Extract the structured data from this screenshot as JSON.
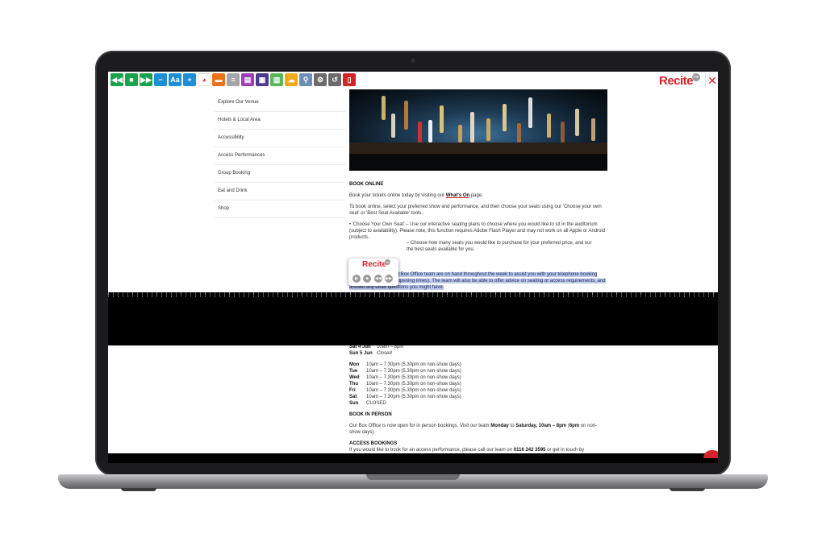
{
  "toolbar": {
    "buttons": [
      {
        "name": "rewind-button",
        "icon": "rewind-icon",
        "glyph": "◀◀",
        "color": "#1aa14b"
      },
      {
        "name": "stop-button",
        "icon": "stop-icon",
        "glyph": "■",
        "color": "#1aa14b"
      },
      {
        "name": "fast-forward-button",
        "icon": "fast-forward-icon",
        "glyph": "▶▶",
        "color": "#1aa14b"
      },
      {
        "name": "decrease-text-button",
        "icon": "minus-icon",
        "glyph": "−",
        "color": "#1c8fd6"
      },
      {
        "name": "font-button",
        "icon": "font-icon",
        "glyph": "Aa",
        "color": "#1c8fd6"
      },
      {
        "name": "increase-text-button",
        "icon": "plus-icon",
        "glyph": "+",
        "color": "#1c8fd6"
      },
      {
        "name": "color-button",
        "icon": "color-wheel-icon",
        "glyph": "◕",
        "color": "#ffffff"
      },
      {
        "name": "ruler-button",
        "icon": "ruler-icon",
        "glyph": "▬",
        "color": "#e8731a"
      },
      {
        "name": "margins-button",
        "icon": "margins-icon",
        "glyph": "≡",
        "color": "#a5a5a5"
      },
      {
        "name": "reader-button",
        "icon": "book-icon",
        "glyph": "▤",
        "color": "#9b3fb5"
      },
      {
        "name": "translate-button",
        "icon": "translate-icon",
        "glyph": "▦",
        "color": "#4d3a8c"
      },
      {
        "name": "dictionary-button",
        "icon": "dictionary-icon",
        "glyph": "▥",
        "color": "#5ab55f"
      },
      {
        "name": "download-audio-button",
        "icon": "cloud-download-icon",
        "glyph": "☁",
        "color": "#f2a81d"
      },
      {
        "name": "magnifier-button",
        "icon": "magnifier-icon",
        "glyph": "⚲",
        "color": "#6e8fb3"
      },
      {
        "name": "settings-button",
        "icon": "gear-icon",
        "glyph": "⚙",
        "color": "#6b6b6b"
      },
      {
        "name": "reset-button",
        "icon": "reset-icon",
        "glyph": "↺",
        "color": "#6b6b6b"
      },
      {
        "name": "help-button",
        "icon": "help-icon",
        "glyph": "▯",
        "color": "#d4232b"
      }
    ],
    "logo": "Recite",
    "badge": "me",
    "close_glyph": "✕"
  },
  "nav": {
    "items": [
      "Explore Our Venue",
      "Hotels & Local Area",
      "Accessibility",
      "Access Performances",
      "Group Booking",
      "Eat and Drink",
      "Shop"
    ]
  },
  "main": {
    "book_online_heading": "BOOK ONLINE",
    "line1_pre": "Book your tickets online today by visiting our ",
    "line1_link": "What's On",
    "line1_post": " page.",
    "para2": "To book online, select your preferred show and performance, and then choose your seats using our 'Choose your own seat' or 'Best Seat Available' tools.",
    "bullet1": "• 'Choose Your Own Seat' – Use our interactive seating plans to choose where you would like to sit in the auditorium (subject to availability). Please note, this function requires Adobe Flash Player and may not work on all Apple or Android products.",
    "bullet2_a": "– Choose how many seats you would like to purchase for your preferred price, and our",
    "bullet2_b": "the best seats available for you.",
    "highlight": "Our friendly and helpful Box Office team are on hand throughout the week to assist you with your telephone booking (see below for current opening times). The team will also be able to offer advice on seating or access requirements, and answer any other questions you might have."
  },
  "popup": {
    "logo": "Recite",
    "badge": "me",
    "play": "▶",
    "stop": "■",
    "back": "◀◀",
    "forward": "▶▶"
  },
  "hours": {
    "top_rows": [
      {
        "day": "Sat 4 Jun",
        "time": "10am – 8pm"
      },
      {
        "day": "Sun 5 Jun",
        "time": "Closed"
      }
    ],
    "rows": [
      {
        "day": "Mon",
        "time": "10am – 7.30pm (5.30pm on non-show days)"
      },
      {
        "day": "Tue",
        "time": "10am – 7.30pm (5.30pm on non-show days)"
      },
      {
        "day": "Wed",
        "time": "10am – 7.30pm (5.30pm on non-show days)"
      },
      {
        "day": "Thu",
        "time": "10am – 7.30pm (5.30pm on non-show days)"
      },
      {
        "day": "Fri",
        "time": "10am – 7.30pm (5.30pm on non-show days)"
      },
      {
        "day": "Sat",
        "time": "10am – 7.30pm (5.30pm on non-show days)"
      },
      {
        "day": "Sun",
        "time": "CLOSED"
      }
    ],
    "book_in_person_heading": "BOOK IN PERSON",
    "in_person_a": "Our Box Office is now open for in person bookings. Visit our team ",
    "in_person_mon": "Monday",
    "in_person_to": " to ",
    "in_person_sat": "Saturday, 10am – 8pm",
    "in_person_paren_open": " (",
    "in_person_6pm": "6pm",
    "in_person_rest": " on non-show days).",
    "access_heading": "ACCESS BOOKINGS",
    "access_a": "If you would like to book for an access performance, please call our team on ",
    "access_phone": "0116 242 3595",
    "access_b": " or get in touch by"
  }
}
